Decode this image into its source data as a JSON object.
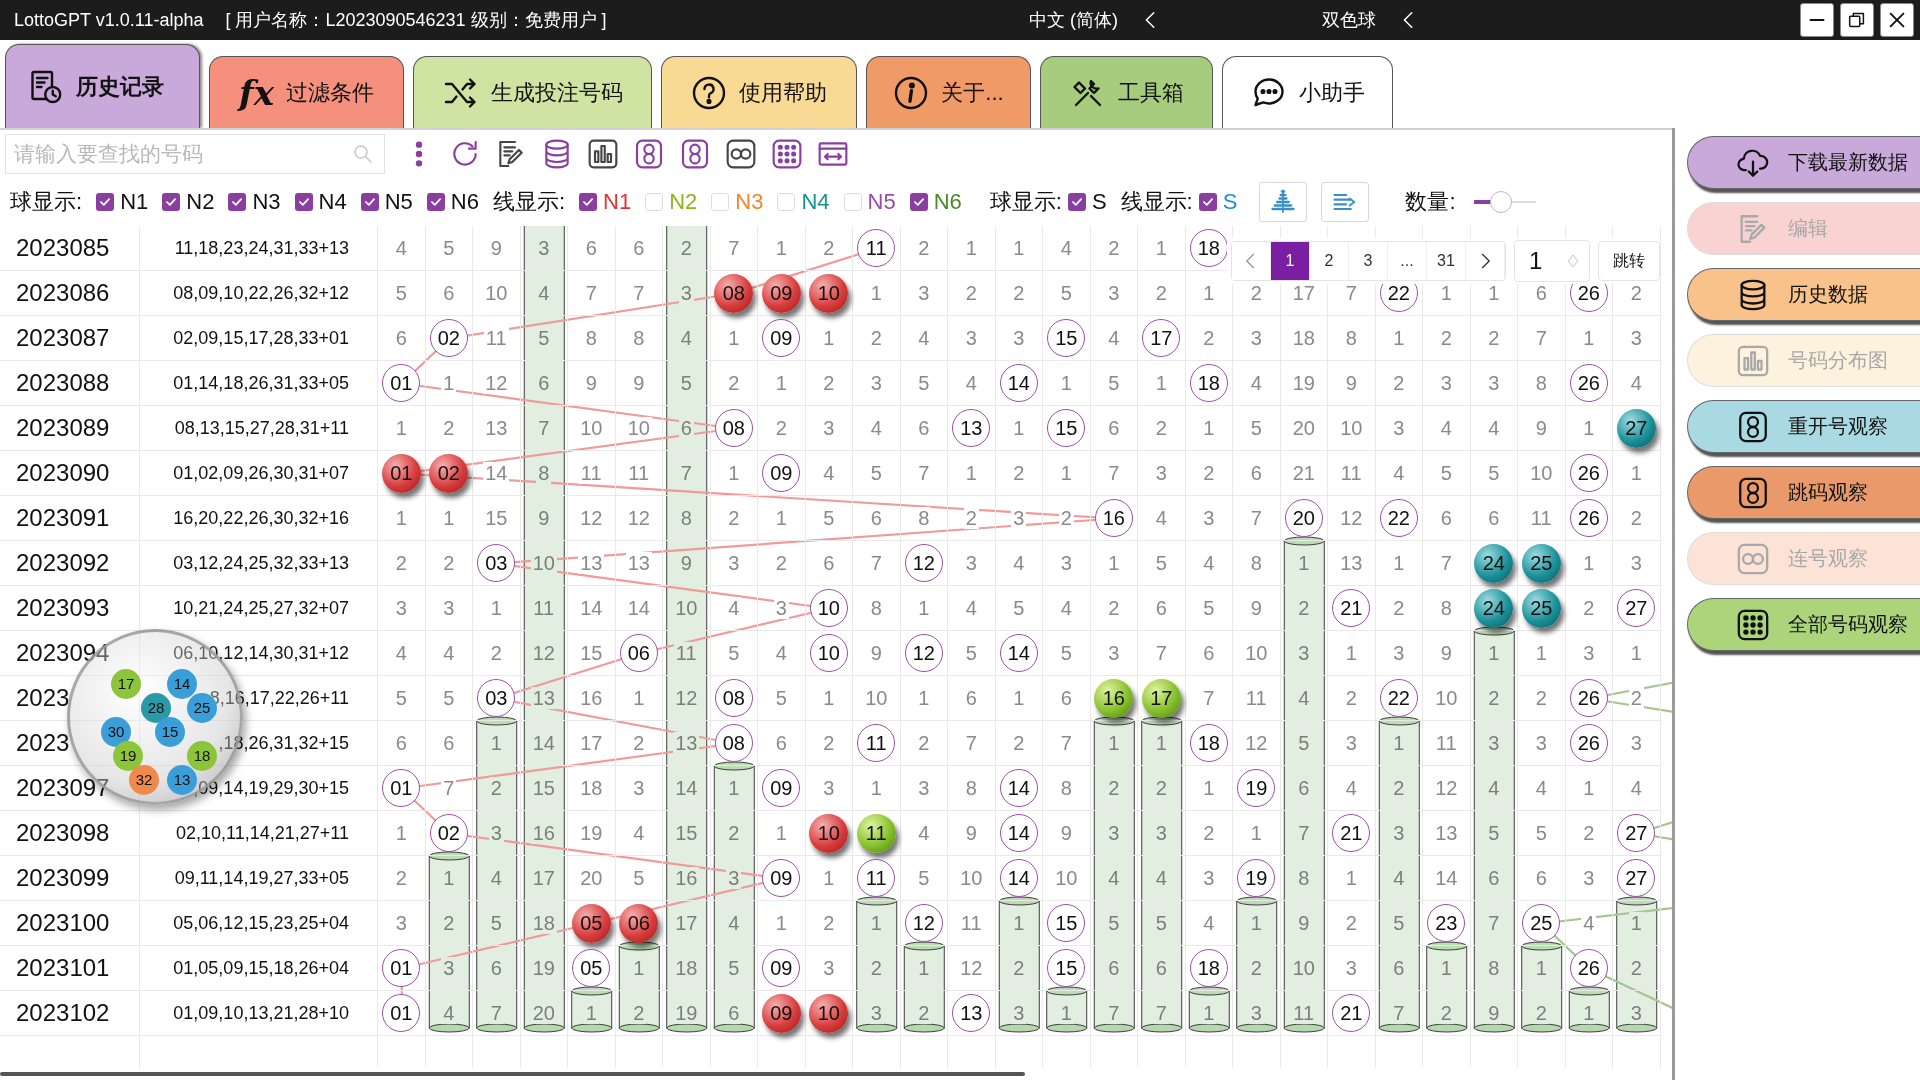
{
  "window": {
    "title": "LottoGPT v1.0.11-alpha",
    "user_info": "[ 用户名称：L2023090546231   级别：免费用户 ]",
    "language": "中文 (简体)",
    "game": "双色球"
  },
  "tabs": [
    {
      "label": "历史记录",
      "selected": true,
      "color": "#c9a9d9"
    },
    {
      "label": "过滤条件",
      "selected": false,
      "color": "#f4907c",
      "glyph": "fx"
    },
    {
      "label": "生成投注号码",
      "selected": false,
      "color": "#cfe3a3"
    },
    {
      "label": "使用帮助",
      "selected": false,
      "color": "#f9da94"
    },
    {
      "label": "关于...",
      "selected": false,
      "color": "#f09a68"
    },
    {
      "label": "工具箱",
      "selected": false,
      "color": "#a6cc7e"
    },
    {
      "label": "小助手",
      "selected": false,
      "color": "#ffffff"
    }
  ],
  "search": {
    "placeholder": "请输入要查找的号码"
  },
  "ball_display": {
    "label": "球显示:",
    "items": [
      {
        "label": "N1",
        "checked": true
      },
      {
        "label": "N2",
        "checked": true
      },
      {
        "label": "N3",
        "checked": true
      },
      {
        "label": "N4",
        "checked": true
      },
      {
        "label": "N5",
        "checked": true
      },
      {
        "label": "N6",
        "checked": true
      }
    ]
  },
  "line_display": {
    "label": "线显示:",
    "items": [
      {
        "label": "N1",
        "checked": true,
        "color": "#e03434"
      },
      {
        "label": "N2",
        "checked": false,
        "color": "#8db41e"
      },
      {
        "label": "N3",
        "checked": false,
        "color": "#f0862e"
      },
      {
        "label": "N4",
        "checked": false,
        "color": "#14938f"
      },
      {
        "label": "N5",
        "checked": false,
        "color": "#9a4aaa"
      },
      {
        "label": "N6",
        "checked": true,
        "color": "#4c8a24"
      }
    ]
  },
  "special_ball_display": {
    "label": "球显示:",
    "item": {
      "label": "S",
      "checked": true
    }
  },
  "special_line_display": {
    "label": "线显示:",
    "item": {
      "label": "S",
      "checked": true,
      "color": "#1e8fd2"
    }
  },
  "quantity": {
    "label": "数量:",
    "level": 0.45
  },
  "pagination": {
    "pages": [
      {
        "label": "1",
        "selected": true
      },
      {
        "label": "2",
        "selected": false
      },
      {
        "label": "3",
        "selected": false
      },
      {
        "label": "...",
        "selected": false
      },
      {
        "label": "31",
        "selected": false
      }
    ],
    "page_input": "1",
    "jump_button": "跳转"
  },
  "table": {
    "rows": [
      {
        "period": "2023085",
        "numbers": "11,18,23,24,31,33+13",
        "cells": [
          "4",
          "5",
          "9",
          "3",
          "6",
          "6",
          "2",
          "7",
          "1",
          "2",
          {
            "text": "11",
            "kind": "hit"
          },
          "2",
          "1",
          "1",
          "4",
          "2",
          "1",
          {
            "text": "18",
            "kind": "hit"
          }
        ]
      },
      {
        "period": "2023086",
        "numbers": "08,09,10,22,26,32+12",
        "cells": [
          "5",
          "6",
          "10",
          "4",
          "7",
          "7",
          "3",
          {
            "text": "08",
            "kind": "red"
          },
          {
            "text": "09",
            "kind": "red"
          },
          {
            "text": "10",
            "kind": "red"
          },
          "1",
          "3",
          "2",
          "2",
          "5",
          "3",
          "2",
          "1",
          "2",
          "17",
          "7",
          {
            "text": "22",
            "kind": "hit"
          },
          "1",
          "1",
          "6",
          {
            "text": "26",
            "kind": "hit"
          },
          "2"
        ]
      },
      {
        "period": "2023087",
        "numbers": "02,09,15,17,28,33+01",
        "cells": [
          "6",
          {
            "text": "02",
            "kind": "hit"
          },
          "11",
          "5",
          "8",
          "8",
          "4",
          "1",
          {
            "text": "09",
            "kind": "hit"
          },
          "1",
          "2",
          "4",
          "3",
          "3",
          {
            "text": "15",
            "kind": "hit"
          },
          "4",
          {
            "text": "17",
            "kind": "hit"
          },
          "2",
          "3",
          "18",
          "8",
          "1",
          "2",
          "2",
          "7",
          "1",
          "3"
        ]
      },
      {
        "period": "2023088",
        "numbers": "01,14,18,26,31,33+05",
        "cells": [
          {
            "text": "01",
            "kind": "hit"
          },
          "1",
          "12",
          "6",
          "9",
          "9",
          "5",
          "2",
          "1",
          "2",
          "3",
          "5",
          "4",
          {
            "text": "14",
            "kind": "hit"
          },
          "1",
          "5",
          "1",
          {
            "text": "18",
            "kind": "hit"
          },
          "4",
          "19",
          "9",
          "2",
          "3",
          "3",
          "8",
          {
            "text": "26",
            "kind": "hit"
          },
          "4"
        ]
      },
      {
        "period": "2023089",
        "numbers": "08,13,15,27,28,31+11",
        "cells": [
          "1",
          "2",
          "13",
          "7",
          "10",
          "10",
          "6",
          {
            "text": "08",
            "kind": "hit"
          },
          "2",
          "3",
          "4",
          "6",
          {
            "text": "13",
            "kind": "hit"
          },
          "1",
          {
            "text": "15",
            "kind": "hit"
          },
          "6",
          "2",
          "1",
          "5",
          "20",
          "10",
          "3",
          "4",
          "4",
          "9",
          "1",
          {
            "text": "27",
            "kind": "teal"
          }
        ]
      },
      {
        "period": "2023090",
        "numbers": "01,02,09,26,30,31+07",
        "cells": [
          {
            "text": "01",
            "kind": "red"
          },
          {
            "text": "02",
            "kind": "red"
          },
          "14",
          "8",
          "11",
          "11",
          "7",
          "1",
          {
            "text": "09",
            "kind": "hit"
          },
          "4",
          "5",
          "7",
          "1",
          "2",
          "1",
          "7",
          "3",
          "2",
          "6",
          "21",
          "11",
          "4",
          "5",
          "5",
          "10",
          {
            "text": "26",
            "kind": "hit"
          },
          "1"
        ]
      },
      {
        "period": "2023091",
        "numbers": "16,20,22,26,30,32+16",
        "cells": [
          "1",
          "1",
          "15",
          "9",
          "12",
          "12",
          "8",
          "2",
          "1",
          "5",
          "6",
          "8",
          "2",
          "3",
          "2",
          {
            "text": "16",
            "kind": "hit"
          },
          "4",
          "3",
          "7",
          {
            "text": "20",
            "kind": "hit"
          },
          "12",
          {
            "text": "22",
            "kind": "hit"
          },
          "6",
          "6",
          "11",
          {
            "text": "26",
            "kind": "hit"
          },
          "2"
        ]
      },
      {
        "period": "2023092",
        "numbers": "03,12,24,25,32,33+13",
        "cells": [
          "2",
          "2",
          {
            "text": "03",
            "kind": "hit"
          },
          "10",
          "13",
          "13",
          "9",
          "3",
          "2",
          "6",
          "7",
          {
            "text": "12",
            "kind": "hit"
          },
          "3",
          "4",
          "3",
          "1",
          "5",
          "4",
          "8",
          "1",
          "13",
          "1",
          "7",
          {
            "text": "24",
            "kind": "teal"
          },
          {
            "text": "25",
            "kind": "teal"
          },
          "1",
          "3"
        ]
      },
      {
        "period": "2023093",
        "numbers": "10,21,24,25,27,32+07",
        "cells": [
          "3",
          "3",
          "1",
          "11",
          "14",
          "14",
          "10",
          "4",
          "3",
          {
            "text": "10",
            "kind": "hit"
          },
          "8",
          "1",
          "4",
          "5",
          "4",
          "2",
          "6",
          "5",
          "9",
          "2",
          {
            "text": "21",
            "kind": "hit"
          },
          "2",
          "8",
          {
            "text": "24",
            "kind": "teal"
          },
          {
            "text": "25",
            "kind": "teal"
          },
          "2",
          {
            "text": "27",
            "kind": "hit"
          }
        ]
      },
      {
        "period": "2023094",
        "numbers": "06,10,12,14,30,31+12",
        "cells": [
          "4",
          "4",
          "2",
          "12",
          "15",
          {
            "text": "06",
            "kind": "hit"
          },
          "11",
          "5",
          "4",
          {
            "text": "10",
            "kind": "hit"
          },
          "9",
          {
            "text": "12",
            "kind": "hit"
          },
          "5",
          {
            "text": "14",
            "kind": "hit"
          },
          "5",
          "3",
          "7",
          "6",
          "10",
          "3",
          "1",
          "3",
          "9",
          "1",
          "1",
          "3",
          "1"
        ]
      },
      {
        "period": "2023",
        "numbers": "8,16,17,22,26+11",
        "cells": [
          "5",
          "5",
          {
            "text": "03",
            "kind": "hit"
          },
          "13",
          "16",
          "1",
          "12",
          {
            "text": "08",
            "kind": "hit"
          },
          "5",
          "1",
          "10",
          "1",
          "6",
          "1",
          "6",
          {
            "text": "16",
            "kind": "green"
          },
          {
            "text": "17",
            "kind": "green"
          },
          "7",
          "11",
          "4",
          "2",
          {
            "text": "22",
            "kind": "hit"
          },
          "10",
          "2",
          "2",
          {
            "text": "26",
            "kind": "hit"
          },
          "2"
        ]
      },
      {
        "period": "2023",
        "numbers": ",18,26,31,32+15",
        "cells": [
          "6",
          "6",
          "1",
          "14",
          "17",
          "2",
          "13",
          {
            "text": "08",
            "kind": "hit"
          },
          "6",
          "2",
          {
            "text": "11",
            "kind": "hit"
          },
          "2",
          "7",
          "2",
          "7",
          "1",
          "1",
          {
            "text": "18",
            "kind": "hit"
          },
          "12",
          "5",
          "3",
          "1",
          "11",
          "3",
          "3",
          {
            "text": "26",
            "kind": "hit"
          },
          "3"
        ]
      },
      {
        "period": "2023097",
        "numbers": ",09,14,19,29,30+15",
        "cells": [
          {
            "text": "01",
            "kind": "hit"
          },
          "7",
          "2",
          "15",
          "18",
          "3",
          "14",
          "1",
          {
            "text": "09",
            "kind": "hit"
          },
          "3",
          "1",
          "3",
          "8",
          {
            "text": "14",
            "kind": "hit"
          },
          "8",
          "2",
          "2",
          "1",
          {
            "text": "19",
            "kind": "hit"
          },
          "6",
          "4",
          "2",
          "12",
          "4",
          "4",
          "1",
          "4"
        ]
      },
      {
        "period": "2023098",
        "numbers": "02,10,11,14,21,27+11",
        "cells": [
          "1",
          {
            "text": "02",
            "kind": "hit"
          },
          "3",
          "16",
          "19",
          "4",
          "15",
          "2",
          "1",
          {
            "text": "10",
            "kind": "red"
          },
          {
            "text": "11",
            "kind": "green"
          },
          "4",
          "9",
          {
            "text": "14",
            "kind": "hit"
          },
          "9",
          "3",
          "3",
          "2",
          "1",
          "7",
          {
            "text": "21",
            "kind": "hit"
          },
          "3",
          "13",
          "5",
          "5",
          "2",
          {
            "text": "27",
            "kind": "hit"
          }
        ]
      },
      {
        "period": "2023099",
        "numbers": "09,11,14,19,27,33+05",
        "cells": [
          "2",
          "1",
          "4",
          "17",
          "20",
          "5",
          "16",
          "3",
          {
            "text": "09",
            "kind": "hit"
          },
          "1",
          {
            "text": "11",
            "kind": "hit"
          },
          "5",
          "10",
          {
            "text": "14",
            "kind": "hit"
          },
          "10",
          "4",
          "4",
          "3",
          {
            "text": "19",
            "kind": "hit"
          },
          "8",
          "1",
          "4",
          "14",
          "6",
          "6",
          "3",
          {
            "text": "27",
            "kind": "hit"
          }
        ]
      },
      {
        "period": "2023100",
        "numbers": "05,06,12,15,23,25+04",
        "cells": [
          "3",
          "2",
          "5",
          "18",
          {
            "text": "05",
            "kind": "red"
          },
          {
            "text": "06",
            "kind": "red"
          },
          "17",
          "4",
          "1",
          "2",
          "1",
          {
            "text": "12",
            "kind": "hit"
          },
          "11",
          "1",
          {
            "text": "15",
            "kind": "hit"
          },
          "5",
          "5",
          "4",
          "1",
          "9",
          "2",
          "5",
          {
            "text": "23",
            "kind": "hit"
          },
          "7",
          {
            "text": "25",
            "kind": "hit"
          },
          "4",
          "1"
        ]
      },
      {
        "period": "2023101",
        "numbers": "01,05,09,15,18,26+04",
        "cells": [
          {
            "text": "01",
            "kind": "hit"
          },
          "3",
          "6",
          "19",
          {
            "text": "05",
            "kind": "hit"
          },
          "1",
          "18",
          "5",
          {
            "text": "09",
            "kind": "hit"
          },
          "3",
          "2",
          "1",
          "12",
          "2",
          {
            "text": "15",
            "kind": "hit"
          },
          "6",
          "6",
          {
            "text": "18",
            "kind": "hit"
          },
          "2",
          "10",
          "3",
          "6",
          "1",
          "8",
          "1",
          {
            "text": "26",
            "kind": "hit"
          },
          "2"
        ]
      },
      {
        "period": "2023102",
        "numbers": "01,09,10,13,21,28+10",
        "cells": [
          {
            "text": "01",
            "kind": "hit"
          },
          "4",
          "7",
          "20",
          "1",
          "2",
          "19",
          "6",
          {
            "text": "09",
            "kind": "red"
          },
          {
            "text": "10",
            "kind": "red"
          },
          "3",
          "2",
          {
            "text": "13",
            "kind": "hit"
          },
          "3",
          "1",
          "7",
          "7",
          "1",
          "3",
          "11",
          {
            "text": "21",
            "kind": "hit"
          },
          "7",
          "2",
          "9",
          "2",
          "1",
          "3"
        ]
      }
    ]
  },
  "drum": {
    "balls": [
      {
        "label": "17",
        "color": "#8cc43a"
      },
      {
        "label": "14",
        "color": "#3a9fd8"
      },
      {
        "label": "28",
        "color": "#2a9aa8"
      },
      {
        "label": "25",
        "color": "#3a9fd8"
      },
      {
        "label": "30",
        "color": "#3a9fd8"
      },
      {
        "label": "15",
        "color": "#3a9fd8"
      },
      {
        "label": "19",
        "color": "#8cc43a"
      },
      {
        "label": "18",
        "color": "#8cc43a"
      },
      {
        "label": "32",
        "color": "#f08a4a"
      },
      {
        "label": "13",
        "color": "#3a9fd8"
      }
    ]
  },
  "sidebar": {
    "buttons": [
      {
        "label": "下载最新数据",
        "disabled": false,
        "color": "#c9a9d9"
      },
      {
        "label": "编辑",
        "disabled": true,
        "color": "#f9d2d2"
      },
      {
        "label": "历史数据",
        "disabled": false,
        "color": "#f8c28a"
      },
      {
        "label": "号码分布图",
        "disabled": true,
        "color": "#fcf2de"
      },
      {
        "label": "重开号观察",
        "disabled": false,
        "color": "#a9d9e3"
      },
      {
        "label": "跳码观察",
        "disabled": false,
        "color": "#ea9a6a"
      },
      {
        "label": "连号观察",
        "disabled": true,
        "color": "#fde2d6"
      },
      {
        "label": "全部号码观察",
        "disabled": false,
        "color": "#acd47a"
      }
    ]
  }
}
